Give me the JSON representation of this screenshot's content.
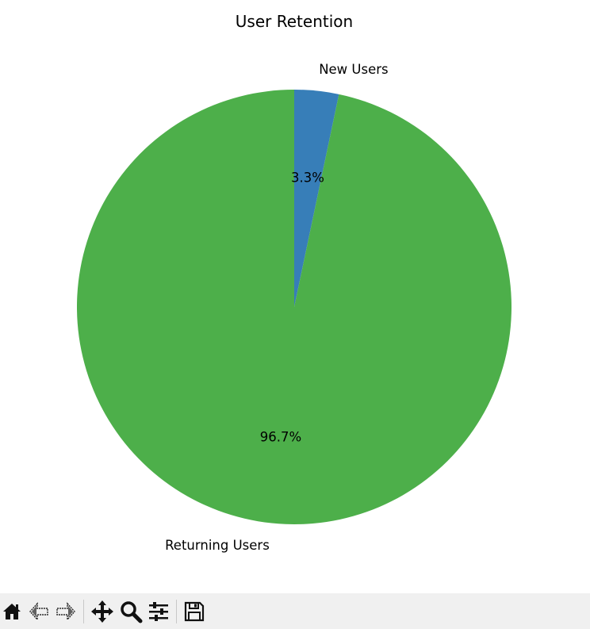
{
  "chart_data": {
    "type": "pie",
    "title": "User Retention",
    "slices": [
      {
        "label": "New Users",
        "value": 3.3,
        "pct_label": "3.3%",
        "color": "#377eb8"
      },
      {
        "label": "Returning Users",
        "value": 96.7,
        "pct_label": "96.7%",
        "color": "#4daf4a"
      }
    ],
    "start_angle_deg": 90,
    "direction": "counterclockwise-reversed"
  },
  "toolbar": {
    "buttons": [
      {
        "name": "home-icon"
      },
      {
        "name": "back-icon"
      },
      {
        "name": "forward-icon"
      },
      {
        "name": "pan-icon"
      },
      {
        "name": "zoom-icon"
      },
      {
        "name": "configure-subplots-icon"
      },
      {
        "name": "save-icon"
      }
    ],
    "background": "#f0f0f0"
  }
}
